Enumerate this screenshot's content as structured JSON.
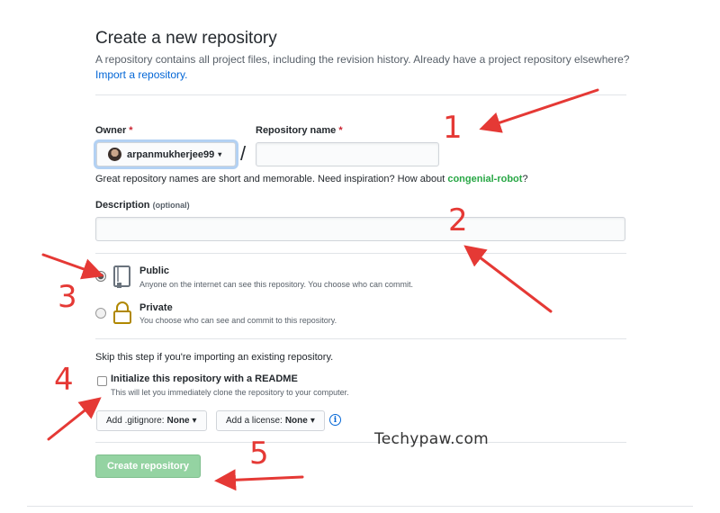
{
  "page": {
    "title": "Create a new repository",
    "subtitle": "A repository contains all project files, including the revision history. Already have a project repository elsewhere?",
    "import_link": "Import a repository."
  },
  "owner": {
    "label": "Owner",
    "required_mark": "*",
    "value": "arpanmukherjee99",
    "caret": "▾"
  },
  "repo_name": {
    "label": "Repository name",
    "required_mark": "*",
    "value": "",
    "separator": "/"
  },
  "name_hint": {
    "text": "Great repository names are short and memorable. Need inspiration? How about",
    "suggestion": "congenial-robot",
    "end": "?"
  },
  "description": {
    "label": "Description",
    "optional": "(optional)",
    "value": ""
  },
  "visibility": {
    "public": {
      "title": "Public",
      "desc": "Anyone on the internet can see this repository. You choose who can commit.",
      "checked": true
    },
    "private": {
      "title": "Private",
      "desc": "You choose who can see and commit to this repository.",
      "checked": false
    }
  },
  "init": {
    "skip_text": "Skip this step if you're importing an existing repository.",
    "readme_title": "Initialize this repository with a README",
    "readme_desc": "This will let you immediately clone the repository to your computer.",
    "readme_checked": false,
    "gitignore_label": "Add .gitignore:",
    "gitignore_value": "None",
    "license_label": "Add a license:",
    "license_value": "None",
    "caret": "▾",
    "info_icon": "i"
  },
  "create_button": "Create repository",
  "watermark": "Techypaw.com",
  "annotations": {
    "color": "#e53935",
    "numbers": [
      "1",
      "2",
      "3",
      "4",
      "5"
    ]
  },
  "colors": {
    "link": "#0366d6",
    "required": "#cb2431",
    "suggestion": "#28a745",
    "create_button_bg": "#94d3a2"
  }
}
